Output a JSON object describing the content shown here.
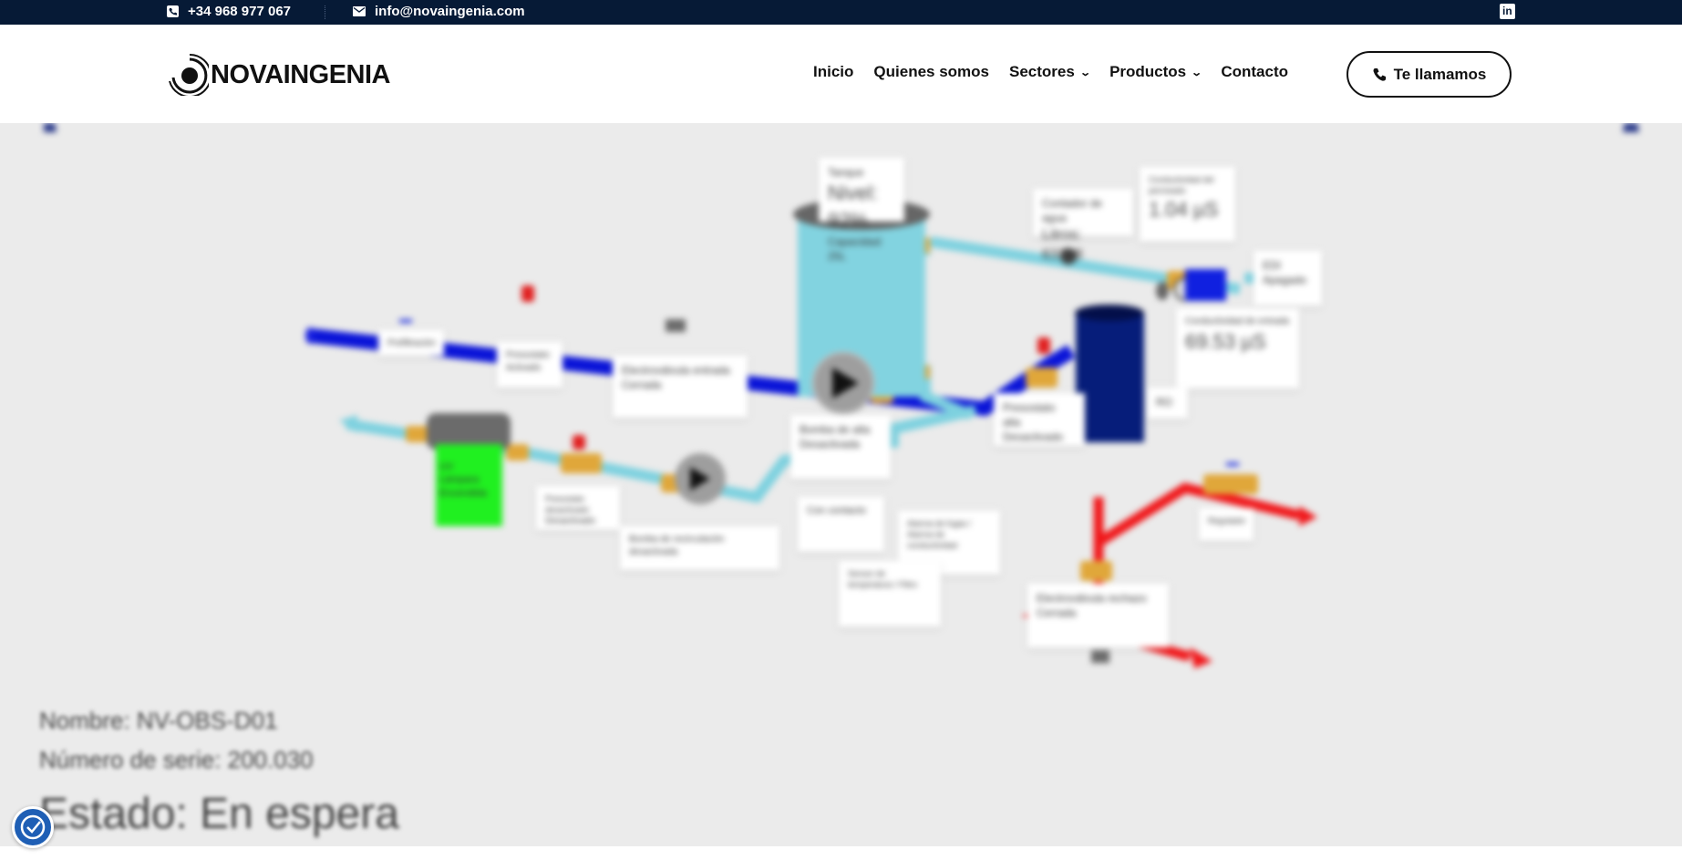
{
  "topbar": {
    "phone": "+34 968 977 067",
    "email": "info@novaingenia.com"
  },
  "header": {
    "logo_text": "NOVAINGENIA",
    "nav": [
      {
        "label": "Inicio"
      },
      {
        "label": "Quienes somos"
      },
      {
        "label": "Sectores"
      },
      {
        "label": "Productos"
      },
      {
        "label": "Contacto"
      }
    ],
    "cta_label": "Te llamamos"
  },
  "diagram": {
    "tank_card": {
      "line1": "Tanque",
      "line2": "Nivel: 92%",
      "line3": "Capacidad: 25L"
    },
    "contador_card": {
      "line1": "Contador de agua",
      "line2": "Litros: 63108"
    },
    "conductividad_perm_card": {
      "line1": "Conductividad del permeado",
      "line2": "1.04 µS"
    },
    "edi_card": {
      "line1": "EDI",
      "line2": "Apagado"
    },
    "conductividad_entrada_card": {
      "line1": "Conductividad de entrada",
      "line2": "69.53 µS"
    },
    "ro_label": "RO",
    "bomba_card": {
      "line1": "Bomba de alta",
      "line2": "Desactivada"
    },
    "presostato_alta_card": {
      "line1": "Presostato alta",
      "line2": "Desactivado"
    },
    "electrovalvula_entrada_card": {
      "line1": "Electroválvula entrada",
      "line2": "Cerrada"
    },
    "presostato_card": {
      "line1": "Presostato",
      "line2": "Activado"
    },
    "prefiltro_label": "Prefiltración",
    "uv_label": [
      "UV",
      "Lámpara",
      "Encendida"
    ],
    "presostato_desactivado_card": {
      "line1": "Presostato desactivado",
      "line2": "Desactivado"
    },
    "bomba_recirculacion_label": "Bomba de recirculación desactivada",
    "con_contacto_label": "Con contacto",
    "alarma_label": "Alarma de fugas / Alarma de conductividad",
    "sensor_label": "Sensor de temperatura / Filtro",
    "electrovalvula_rechazo_card": {
      "line1": "Electroválvula rechazo",
      "line2": "Cerrada"
    },
    "regulador_label": "Regulador"
  },
  "machine": {
    "nombre": "Nombre: NV-OBS-D01",
    "serie": "Número de serie: 200.030",
    "estado": "Estado: En espera"
  },
  "colors": {
    "topbar": "#061a36",
    "pipe_blue": "#0a14d8",
    "pipe_light": "#7ed1df",
    "pipe_red": "#f0171a",
    "valve": "#e0a73a",
    "tank": "#82d3e0",
    "ro_vessel": "#061d7a",
    "uv_green": "#20f020"
  }
}
